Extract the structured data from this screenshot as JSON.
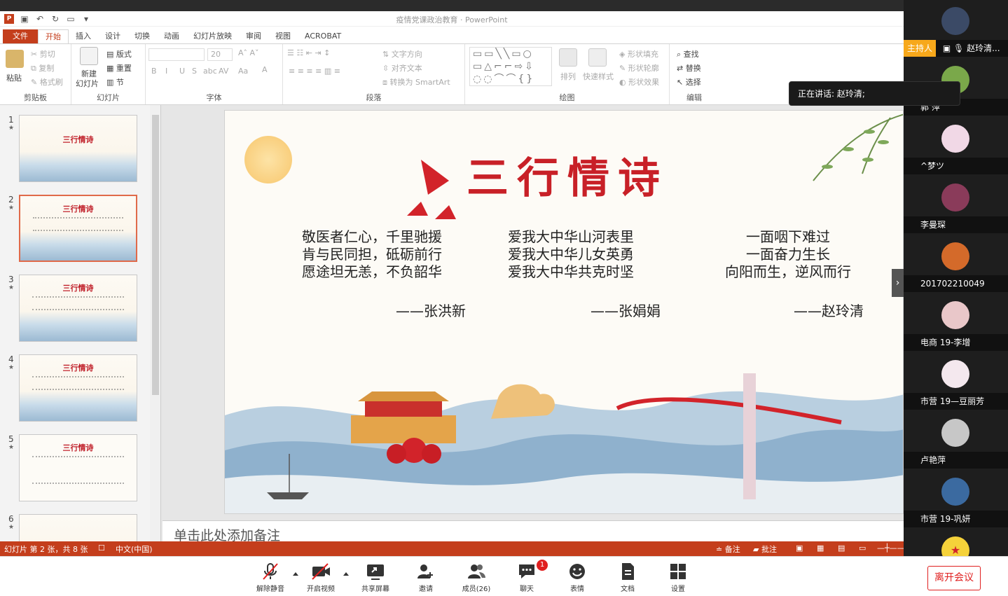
{
  "ppt": {
    "window_title": "疫情党课政治教育 · PowerPoint",
    "tabs": [
      {
        "label": "文件"
      },
      {
        "label": "开始"
      },
      {
        "label": "插入"
      },
      {
        "label": "设计"
      },
      {
        "label": "切换"
      },
      {
        "label": "动画"
      },
      {
        "label": "幻灯片放映"
      },
      {
        "label": "审阅"
      },
      {
        "label": "视图"
      },
      {
        "label": "ACROBAT"
      }
    ],
    "ribbon": {
      "clipboard": {
        "paste": "粘贴",
        "cut": "剪切",
        "copy": "复制",
        "format_painter": "格式刷",
        "label": "剪贴板"
      },
      "slides": {
        "new_slide": "新建",
        "new_slide2": "幻灯片",
        "layout": "版式",
        "reset": "重置",
        "section": "节",
        "label": "幻灯片"
      },
      "font": {
        "size": "20",
        "label": "字体",
        "bold": "B",
        "italic": "I",
        "underline": "U",
        "shadow": "S",
        "strike": "abc",
        "spacing": "AV",
        "case": "Aa"
      },
      "paragraph": {
        "text_direction": "文字方向",
        "align_text": "对齐文本",
        "smartart": "转换为 SmartArt",
        "label": "段落"
      },
      "drawing": {
        "arrange": "排列",
        "quick_styles": "快速样式",
        "shape_fill": "形状填充",
        "shape_outline": "形状轮廓",
        "shape_effects": "形状效果",
        "label": "绘图"
      },
      "editing": {
        "find": "查找",
        "replace": "替换",
        "select": "选择",
        "label": "编辑"
      }
    },
    "thumbnails": [
      {
        "num": "1",
        "title": "三行情诗"
      },
      {
        "num": "2",
        "title": "三行情诗"
      },
      {
        "num": "3",
        "title": "三行情诗"
      },
      {
        "num": "4",
        "title": "三行情诗"
      },
      {
        "num": "5",
        "title": "三行情诗"
      },
      {
        "num": "6",
        "title": ""
      }
    ],
    "slide": {
      "title": "三行情诗",
      "poems": [
        {
          "lines": [
            "敬医者仁心，千里驰援",
            "肯与民同担，砥砺前行",
            "愿途坦无恙，不负韶华"
          ],
          "author": "——张洪新"
        },
        {
          "lines": [
            "爱我大中华山河表里",
            "爱我大中华儿女英勇",
            "爱我大中华共克时坚"
          ],
          "author": "——张娟娟"
        },
        {
          "lines": [
            "一面咽下难过",
            "一面奋力生长",
            "向阳而生，逆风而行"
          ],
          "author": "——赵玲清"
        }
      ]
    },
    "notes_placeholder": "单击此处添加备注",
    "status": {
      "slide_info": "幻灯片 第 2 张，共 8 张",
      "language": "中文(中国)",
      "notes": "备注",
      "comments": "批注"
    }
  },
  "meeting": {
    "speaking": "正在讲话: 赵玲清;",
    "host_badge": "主持人",
    "participants": [
      {
        "name": "赵玲清...",
        "color": "#3b4a66"
      },
      {
        "name": "郭 萍",
        "color": "#7aa84a"
      },
      {
        "name": "^梦ツ",
        "color": "#f1d8e6"
      },
      {
        "name": "李曼琛",
        "color": "#8a3b5a"
      },
      {
        "name": "201702210049",
        "color": "#d46a2a"
      },
      {
        "name": "电商 19-李增",
        "color": "#e9c7c9"
      },
      {
        "name": "市营 19—豆丽芳",
        "color": "#f4e8ee"
      },
      {
        "name": "卢艳萍",
        "color": "#c7c7c7"
      },
      {
        "name": "市营 19-巩妍",
        "color": "#3b6aa0"
      },
      {
        "name": "",
        "color": "#f5d23a"
      }
    ],
    "toolbar": {
      "mute": "解除静音",
      "video": "开启视频",
      "share": "共享屏幕",
      "invite": "邀请",
      "members": "成员(26)",
      "chat": "聊天",
      "chat_badge": "1",
      "reactions": "表情",
      "docs": "文档",
      "settings": "设置",
      "leave": "离开会议"
    }
  }
}
